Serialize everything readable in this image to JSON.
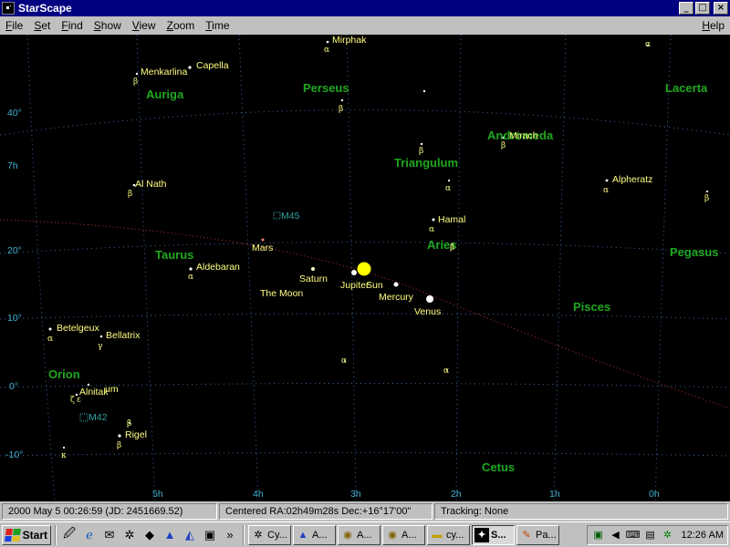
{
  "window": {
    "title": "StarScape",
    "minimize": "_",
    "maximize": "□",
    "close": "×"
  },
  "menu": [
    "File",
    "Set",
    "Find",
    "Show",
    "View",
    "Zoom",
    "Time"
  ],
  "menu_help": "Help",
  "sky": {
    "constellations": {
      "perseus": "Perseus",
      "auriga": "Auriga",
      "lacerta": "Lacerta",
      "andromeda": "Andromeda",
      "triangulum": "Triangulum",
      "taurus": "Taurus",
      "aries": "Aries",
      "pegasus": "Pegasus",
      "pisces": "Pisces",
      "orion": "Orion",
      "cetus": "Cetus"
    },
    "stars": {
      "mirphak": "Mirphak",
      "menkarlina": "Menkarlina",
      "capella": "Capella",
      "mirach": "Mirach",
      "alnath": "Al Nath",
      "alpheratz": "Alpheratz",
      "hamal": "Hamal",
      "aldebaran": "Aldebaran",
      "betelgeux": "Betelgeux",
      "bellatrix": "Bellatrix",
      "alnitak": "Alnitak",
      "rigel": "Rigel",
      "alnilam_fragment": "um"
    },
    "planets": {
      "mars": "Mars",
      "saturn": "Saturn",
      "moon": "The Moon",
      "jupiter": "Jupiter",
      "sun": "Sun",
      "mercury": "Mercury",
      "venus": "Venus"
    },
    "dso": {
      "m45": "M45",
      "m42": "M42"
    },
    "greek": {
      "alpha": "α",
      "beta": "β",
      "gamma": "γ",
      "zeta": "ζ",
      "kappa": "κ",
      "epsilon": "ε"
    },
    "dec_labels": {
      "d40": "40°",
      "d20": "20°",
      "d10": "10°",
      "d0": "0°",
      "dm10": "-10°"
    },
    "ra_labels": {
      "h7_side": "7h",
      "h5": "5h",
      "h4": "4h",
      "h3": "3h",
      "h2": "2h",
      "h1": "1h",
      "h0": "0h"
    },
    "colors": {
      "sky": "#000000",
      "grid": "#3a6aa8",
      "ecliptic": "#c03030",
      "constellation": "#1fa81f",
      "star_label": "#ffff80",
      "sun": "#ffff00",
      "dso": "#30a0a0"
    }
  },
  "status": {
    "datetime": "2000 May 5    00:26:59    (JD: 2451669.52)",
    "centered": "Centered  RA:02h49m28s  Dec:+16°17'00\"",
    "tracking": "Tracking: None"
  },
  "taskbar": {
    "start": "Start",
    "quick_more": "»",
    "tasks": [
      {
        "label": "Cy...",
        "icon": "network-icon"
      },
      {
        "label": "A...",
        "icon": "aol-icon"
      },
      {
        "label": "A...",
        "icon": "globe-icon"
      },
      {
        "label": "A...",
        "icon": "globe-icon"
      },
      {
        "label": "cy...",
        "icon": "folder-icon"
      },
      {
        "label": "S...",
        "icon": "starscape-icon"
      },
      {
        "label": "Pa...",
        "icon": "paint-icon"
      }
    ],
    "clock": "12:26 AM"
  }
}
